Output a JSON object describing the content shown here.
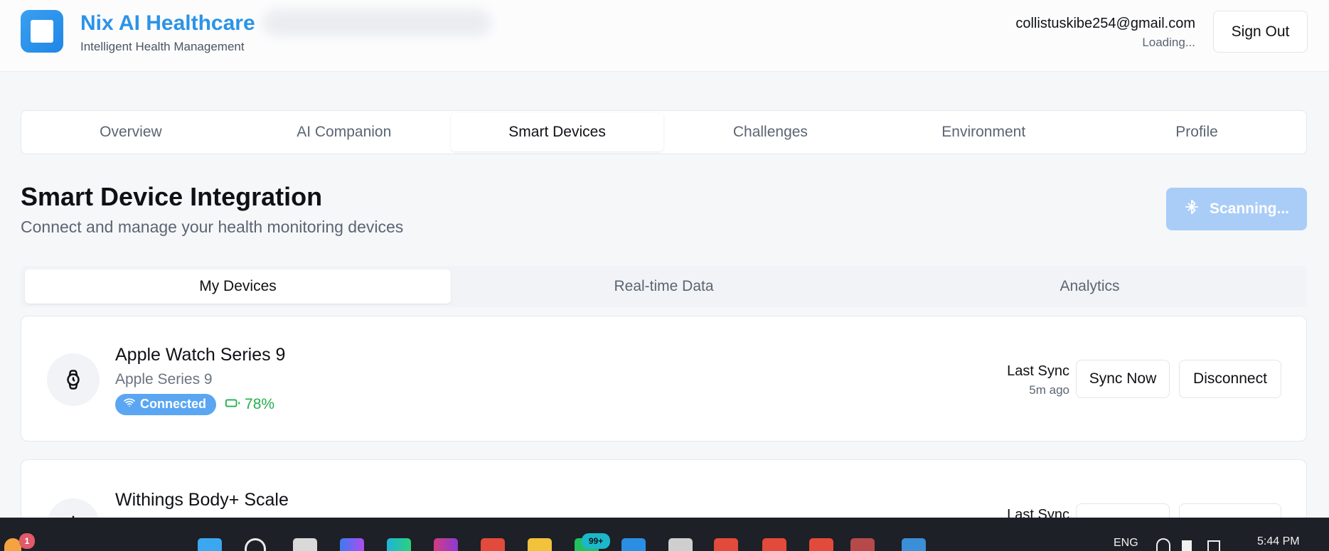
{
  "header": {
    "brand_title": "Nix AI Healthcare",
    "brand_subtitle": "Intelligent Health Management",
    "user_email": "collistuskibe254@gmail.com",
    "user_status": "Loading...",
    "sign_out_label": "Sign Out"
  },
  "main_tabs": [
    {
      "label": "Overview",
      "active": false
    },
    {
      "label": "AI Companion",
      "active": false
    },
    {
      "label": "Smart Devices",
      "active": true
    },
    {
      "label": "Challenges",
      "active": false
    },
    {
      "label": "Environment",
      "active": false
    },
    {
      "label": "Profile",
      "active": false
    }
  ],
  "section": {
    "title": "Smart Device Integration",
    "subtitle": "Connect and manage your health monitoring devices",
    "scan_button_label": "Scanning..."
  },
  "sub_tabs": [
    {
      "label": "My Devices",
      "active": true
    },
    {
      "label": "Real-time Data",
      "active": false
    },
    {
      "label": "Analytics",
      "active": false
    }
  ],
  "devices": [
    {
      "name": "Apple Watch Series 9",
      "model": "Apple Series 9",
      "status": "Connected",
      "battery": "78%",
      "last_sync_label": "Last Sync",
      "last_sync_time": "5m ago",
      "sync_button": "Sync Now",
      "disconnect_button": "Disconnect",
      "icon": "watch-icon"
    },
    {
      "name": "Withings Body+ Scale",
      "last_sync_label": "Last Sync",
      "icon": "scale-icon"
    }
  ],
  "taskbar": {
    "notification_count": "1",
    "chat_badge": "99+",
    "language": "ENG",
    "time": "5:44 PM"
  },
  "colors": {
    "brand": "#2b93e8",
    "badge_connected": "#5aa6f2",
    "battery_green": "#22b04c",
    "scan_button": "#a9cdf7"
  }
}
